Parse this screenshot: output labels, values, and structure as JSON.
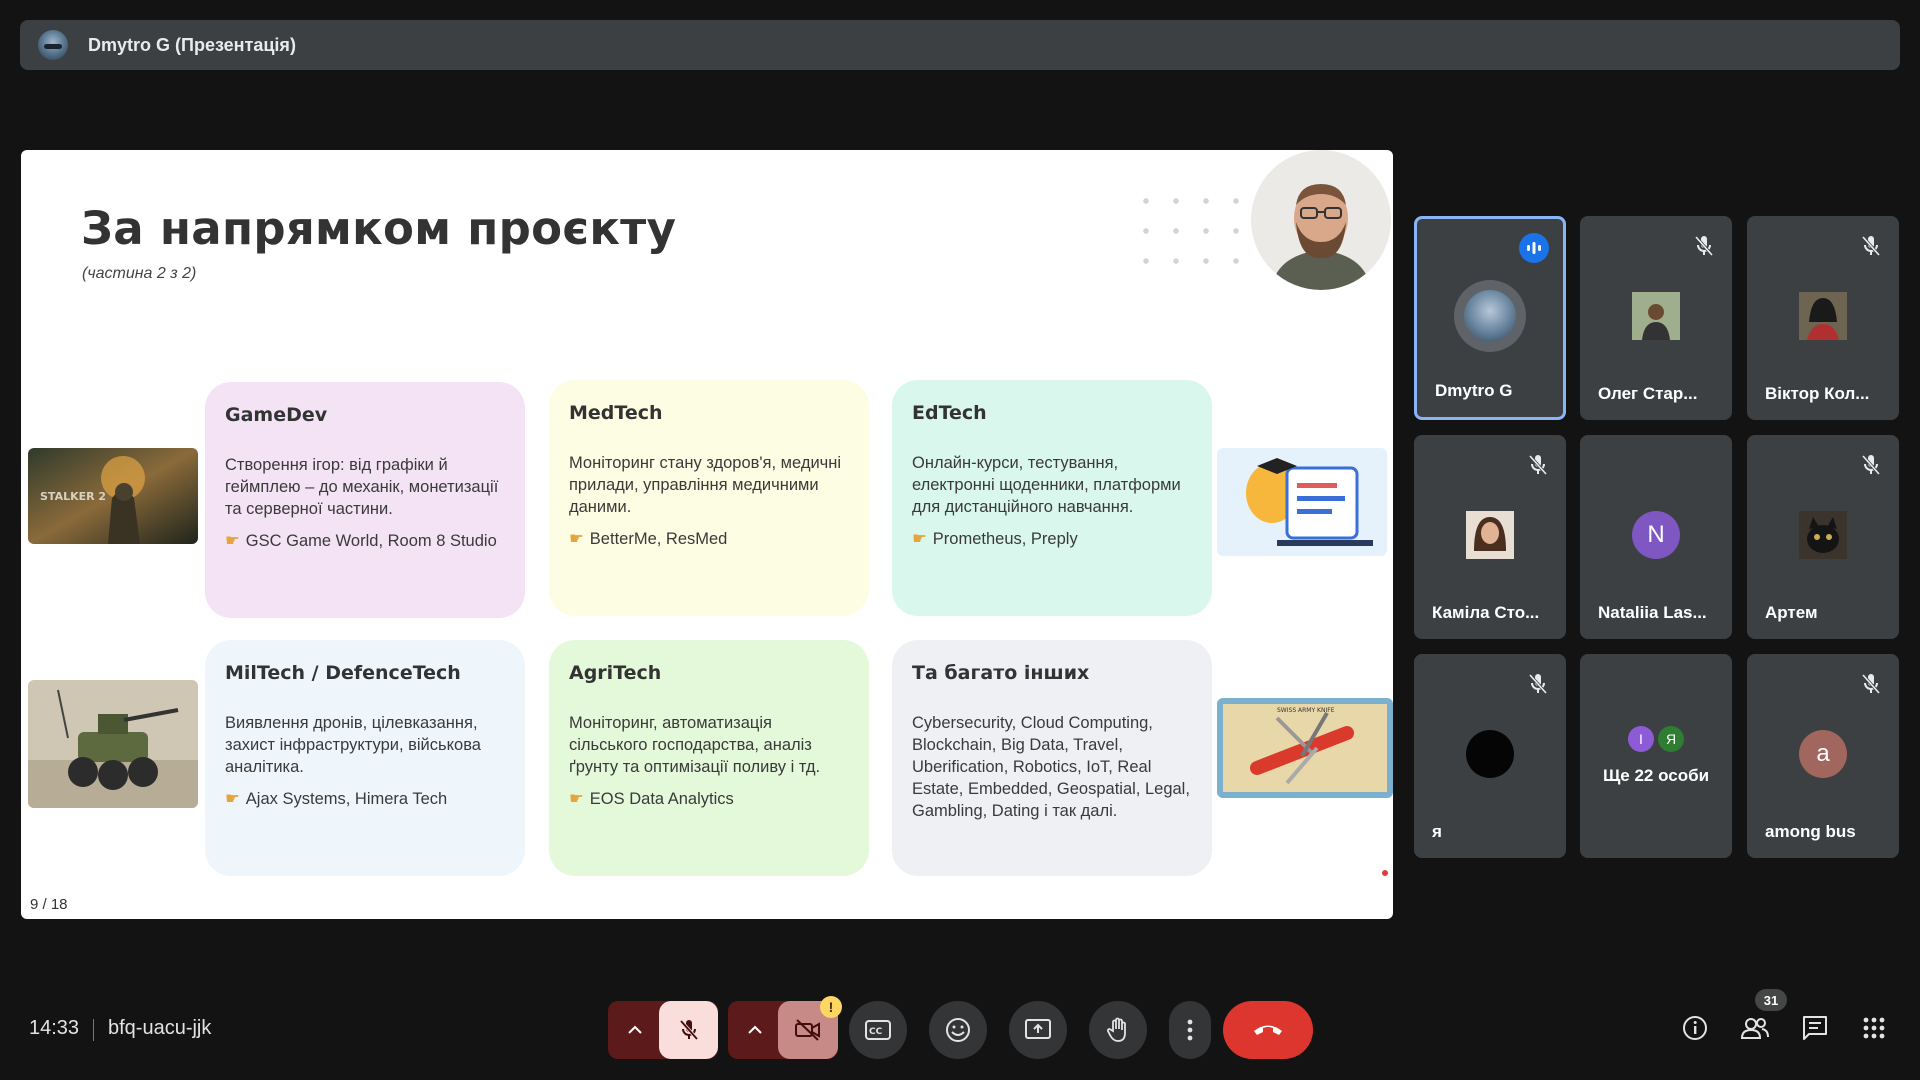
{
  "topbar": {
    "title": "Dmytro G (Презентація)"
  },
  "slide": {
    "title": "За напрямком проєкту",
    "subtitle": "(частина 2 з 2)",
    "page": "9 / 18",
    "cards": [
      {
        "title": "GameDev",
        "text": "Створення ігор: від графіки й геймплею – до механік, монетизації та серверної частини.",
        "companies": "GSC Game World, Room 8 Studio",
        "bg": "#f3e3f5"
      },
      {
        "title": "MedTech",
        "text": "Моніторинг стану здоров'я, медичні прилади, управління медичними даними.",
        "companies": "BetterMe, ResMed",
        "bg": "#fdfde3"
      },
      {
        "title": "EdTech",
        "text": "Онлайн-курси, тестування, електронні щоденники, платформи для дистанційного навчання.",
        "companies": "Prometheus, Preply",
        "bg": "#d9f7ec"
      },
      {
        "title": "MilTech / DefenceTech",
        "text": "Виявлення дронів, цілевказання, захист інфраструктури, військова аналітика.",
        "companies": "Ajax Systems, Himera Tech",
        "bg": "#eef6fc"
      },
      {
        "title": "AgriTech",
        "text": "Моніторинг, автоматизація сільського господарства, аналіз ґрунту та оптимізації поливу і тд.",
        "companies": "EOS Data Analytics",
        "bg": "#e3f9d9"
      },
      {
        "title": "Та багато інших",
        "text": "Cybersecurity, Cloud Computing, Blockchain, Big Data, Travel, Uberification, Robotics, IoT, Real Estate, Embedded, Geospatial, Legal, Gambling, Dating і так далі.",
        "companies": "",
        "bg": "#eef0f3"
      }
    ],
    "stalker_logo": "STALKER 2",
    "swiss_label": "SWISS ARMY KNIFE"
  },
  "participants": [
    {
      "name": "Dmytro G",
      "muted": false,
      "active": true
    },
    {
      "name": "Олег Стар...",
      "muted": true
    },
    {
      "name": "Віктор Кол...",
      "muted": true
    },
    {
      "name": "Каміла Сто...",
      "muted": true
    },
    {
      "name": "Nataliia Las...",
      "muted": false,
      "initial": "N",
      "color": "#7e57c2"
    },
    {
      "name": "Артем",
      "muted": true
    },
    {
      "name": "я",
      "muted": true
    },
    {
      "name": "Ще 22 особи",
      "muted": false,
      "mini": [
        "І",
        "Я"
      ]
    },
    {
      "name": "among bus",
      "muted": true,
      "initial": "a",
      "color": "#a1665e"
    }
  ],
  "bottom": {
    "time": "14:33",
    "meeting_code": "bfq-uacu-jjk",
    "people_count": "31",
    "camera_warning": "!"
  },
  "colors": {
    "end_call": "#dc362e",
    "active_border": "#8ab4f8",
    "speaking": "#1a73e8"
  }
}
